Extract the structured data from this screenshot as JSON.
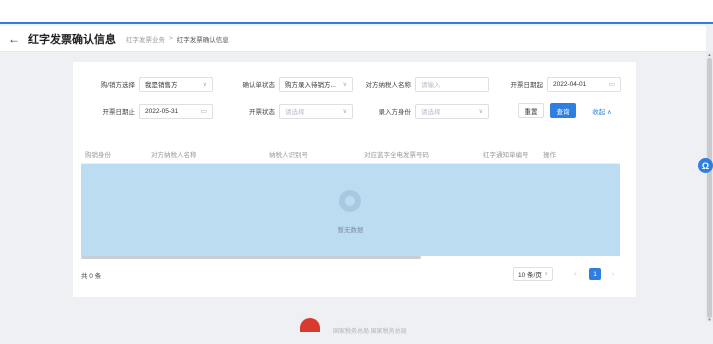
{
  "header": {
    "back_glyph": "←",
    "title": "红字发票确认信息",
    "breadcrumb": [
      "红字发票业务",
      "红字发票确认信息"
    ],
    "breadcrumb_sep": ">"
  },
  "filters": {
    "role": {
      "label": "购/销方选择",
      "value": "我是销售方"
    },
    "confirm_status": {
      "label": "确认单状态",
      "value": "购方录入待销方..."
    },
    "counterpart_name": {
      "label": "对方纳税人名称",
      "placeholder": "请输入"
    },
    "date_start": {
      "label": "开票日期起",
      "value": "2022-04-01"
    },
    "date_end": {
      "label": "开票日期止",
      "value": "2022-05-31"
    },
    "invoice_status": {
      "label": "开票状态",
      "placeholder": "请选择"
    },
    "entry_role": {
      "label": "录入方身份",
      "placeholder": "请选择"
    },
    "reset_label": "重置",
    "query_label": "查询",
    "collapse_label": "收起 ∧"
  },
  "table": {
    "columns": [
      "购销身份",
      "对方纳税人名称",
      "纳税人识别号",
      "对应蓝字全电发票号码",
      "红字通知单编号",
      "操作"
    ],
    "empty_text": "暂无数据"
  },
  "pagination": {
    "total_text": "共 0 条",
    "page_size": "10 条/页",
    "current_page": "1",
    "prev_glyph": "‹",
    "next_glyph": "›"
  },
  "footer": {
    "text": "国家税务总局  国家税务总局"
  },
  "help_icon_glyph": "Ω",
  "colors": {
    "accent": "#2f7fe0",
    "empty_area": "#bcdcf2",
    "emblem": "#d93a2f"
  }
}
